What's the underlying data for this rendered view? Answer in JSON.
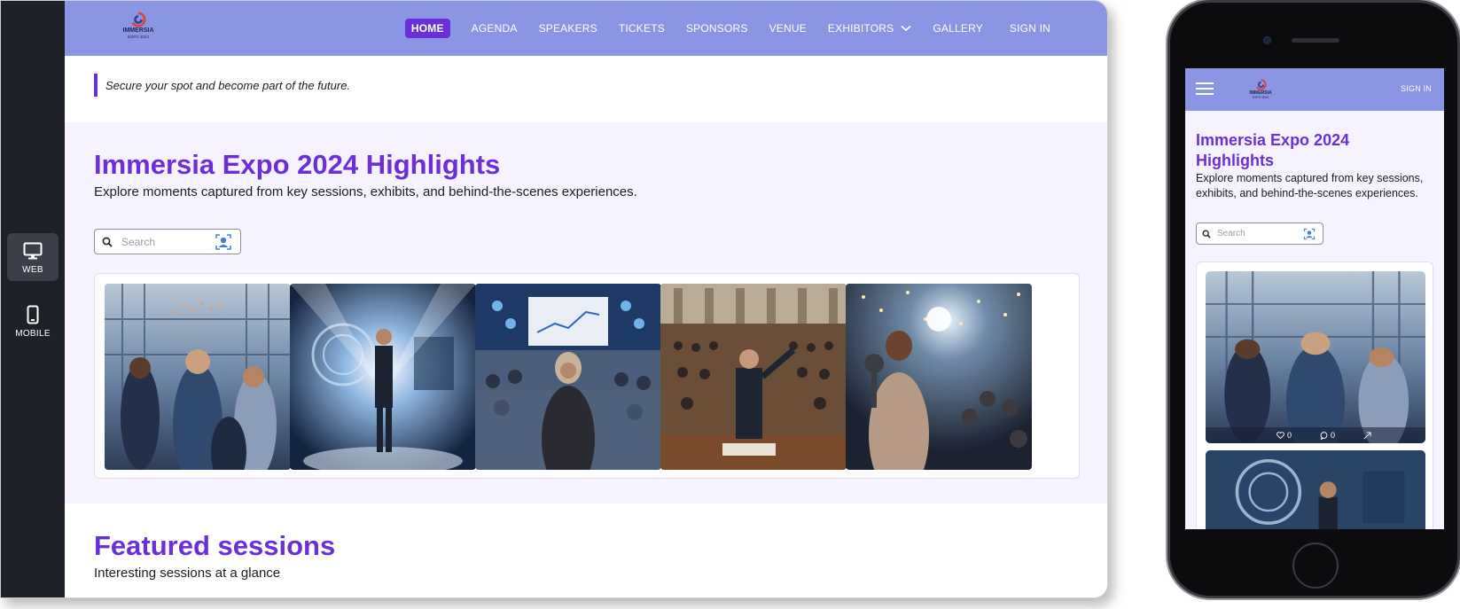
{
  "rail": {
    "web_label": "WEB",
    "mobile_label": "MOBILE"
  },
  "nav": {
    "logo_word": "IMMERSIA",
    "logo_sub": "EXPO 2024",
    "items": [
      "HOME",
      "AGENDA",
      "SPEAKERS",
      "TICKETS",
      "SPONSORS",
      "VENUE",
      "EXHIBITORS",
      "GALLERY"
    ],
    "signin": "SIGN IN"
  },
  "tagline": "Secure your spot and become part of the future.",
  "highlights": {
    "title": "Immersia Expo 2024 Highlights",
    "subtitle": "Explore moments captured from key sessions, exhibits, and behind-the-scenes experiences.",
    "search_placeholder": "Search"
  },
  "featured": {
    "title": "Featured sessions",
    "subtitle": "Interesting sessions at a glance"
  },
  "mobile": {
    "signin": "SIGN IN",
    "title": "Immersia Expo 2024 Highlights",
    "subtitle": "Explore moments captured from key sessions, exhibits, and behind-the-scenes experiences.",
    "search_placeholder": "Search",
    "likes": "0",
    "comments": "0"
  },
  "colors": {
    "accent": "#6a2fd8",
    "nav_bg": "#8a95e3",
    "section_bg": "#f6f2ff",
    "rail_bg": "#1f2128"
  }
}
